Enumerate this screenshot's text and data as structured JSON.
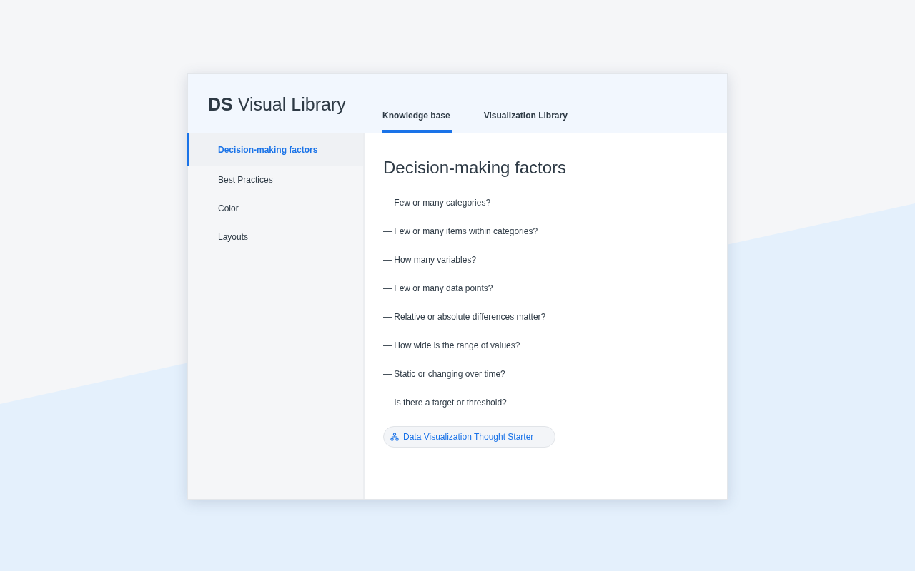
{
  "header": {
    "title": "**DS** Visual Library"
  },
  "tabs": [
    {
      "label": "Knowledge base",
      "selected": true
    },
    {
      "label": "Visualization Library",
      "selected": false
    }
  ],
  "sidebar": {
    "items": [
      {
        "label": "Decision-making factors",
        "selected": true
      },
      {
        "label": "Best Practices",
        "selected": false
      },
      {
        "label": "Color",
        "selected": false
      },
      {
        "label": "Layouts",
        "selected": false
      }
    ]
  },
  "content": {
    "heading": "Decision-making factors",
    "factors": [
      "— Few or many categories?",
      "— Few or many items within categories?",
      "— How many variables?",
      "— Few or many data points?",
      "— Relative or absolute differences matter?",
      "— How wide is the range of values?",
      "— Static or changing over time?",
      "— Is there a target or threshold?"
    ],
    "link_chip": {
      "label": "Data Visualization Thought Starter"
    }
  }
}
